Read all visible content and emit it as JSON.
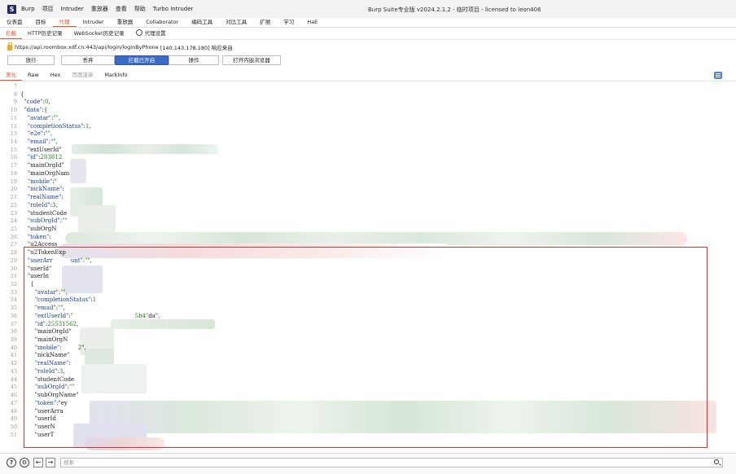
{
  "app": {
    "logo": "S",
    "menu": [
      "Burp",
      "项目",
      "Intruder",
      "重放器",
      "查看",
      "帮助",
      "Turbo Intruder"
    ],
    "title": "Burp Suite专业版  v2024.2.1.2 - 临时项目 - licensed to leon406"
  },
  "top_tabs": [
    "仪表盘",
    "目标",
    "代理",
    "Intruder",
    "重放器",
    "Collaborator",
    "编码工具",
    "对比工具",
    "扩展",
    "学习",
    "HaE"
  ],
  "top_tabs_active": 2,
  "proxy_tabs": [
    "拦截",
    "HTTP历史记录",
    "WebSocket历史记录",
    "代理设置"
  ],
  "proxy_tabs_active": 0,
  "request": {
    "url": "https://api.roombox.xdf.cn:443/api/login/loginByPhone",
    "ip_note": "[140.143.178.180] 响应来自"
  },
  "buttons": {
    "forward": "放行",
    "drop": "丢弃",
    "intercept": "拦截已开启",
    "action": "操作",
    "browser": "打开内嵌浏览器"
  },
  "view_tabs": [
    "美化",
    "Raw",
    "Hex",
    "页面渲染",
    "MarkInfo"
  ],
  "view_tabs_active": 0,
  "code_lines": [
    {
      "n": "7",
      "t": ""
    },
    {
      "n": "8",
      "t": "{"
    },
    {
      "n": "9",
      "t": "  \"code\":0,"
    },
    {
      "n": "10",
      "t": "  \"data\":{"
    },
    {
      "n": "11",
      "t": "    \"avatar\":\"\","
    },
    {
      "n": "12",
      "t": "    \"completionStatus\":1,"
    },
    {
      "n": "13",
      "t": "    \"e2e\":\"\","
    },
    {
      "n": "14",
      "t": "    \"email\":\"\","
    },
    {
      "n": "15",
      "t": "    \"extUserId\""
    },
    {
      "n": "16",
      "t": "    \"id\":283812"
    },
    {
      "n": "17",
      "t": "    \"mainOrgId\""
    },
    {
      "n": "18",
      "t": "    \"mainOrgNam"
    },
    {
      "n": "19",
      "t": "    \"mobile\":\""
    },
    {
      "n": "20",
      "t": "    \"nickName\":"
    },
    {
      "n": "21",
      "t": "    \"realName\":"
    },
    {
      "n": "22",
      "t": "    \"roleId\":3,"
    },
    {
      "n": "23",
      "t": "    \"studentCode"
    },
    {
      "n": "24",
      "t": "    \"subOrgId\":\"\""
    },
    {
      "n": "25",
      "t": "    \"subOrgN"
    },
    {
      "n": "26",
      "t": "    \"token\":"
    },
    {
      "n": "27",
      "t": "    \"u2Access"
    },
    {
      "n": "28",
      "t": "    \"u2TokenExp"
    },
    {
      "n": "29",
      "t": "    \"userArr          unt\":\"\","
    },
    {
      "n": "30",
      "t": "    \"userId\""
    },
    {
      "n": "31",
      "t": "    \"userIn"
    },
    {
      "n": "32",
      "t": "      ["
    },
    {
      "n": "33",
      "t": "        \"avatar\":\"\","
    },
    {
      "n": "34",
      "t": "        \"completionStatus\":1"
    },
    {
      "n": "35",
      "t": "        \"email\":\"\","
    },
    {
      "n": "36",
      "t": "        \"extUserId\":\"                                  5b4\"da\","
    },
    {
      "n": "37",
      "t": "        \"id\":25531562,"
    },
    {
      "n": "38",
      "t": "        \"mainOrgId\""
    },
    {
      "n": "39",
      "t": "        \"mainOrgN"
    },
    {
      "n": "40",
      "t": "        \"mobile\":         2\","
    },
    {
      "n": "41",
      "t": "        \"nickName\""
    },
    {
      "n": "42",
      "t": "        \"realName\":"
    },
    {
      "n": "43",
      "t": "        \"roleId\":3,"
    },
    {
      "n": "44",
      "t": "        \"studentCode"
    },
    {
      "n": "45",
      "t": "        \"subOrgId\":\"\""
    },
    {
      "n": "46",
      "t": "        \"subOrgName\""
    },
    {
      "n": "47",
      "t": "        \"token\":\"ey"
    },
    {
      "n": "48",
      "t": "        \"userArra"
    },
    {
      "n": "49",
      "t": "        \"userId"
    },
    {
      "n": "50",
      "t": "        \"userN"
    },
    {
      "n": "51",
      "t": "        \"userT"
    }
  ],
  "search": {
    "placeholder": "搜索"
  },
  "colors": {
    "accent": "#e8532f",
    "primary": "#3b6bc4",
    "highlight": "#e0302a"
  }
}
